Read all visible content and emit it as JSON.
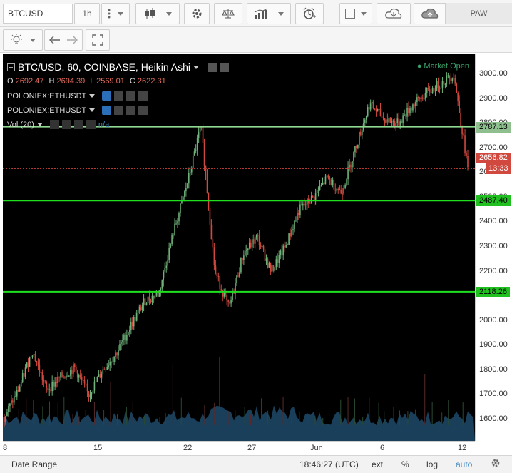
{
  "toolbar": {
    "symbol": "BTCUSD",
    "interval": "1h",
    "paw_label": "PAW",
    "icons": [
      "menu-dots-icon",
      "candles-icon",
      "settings-icon",
      "scales-icon",
      "indicators-icon",
      "alarm-clock-icon",
      "square-icon",
      "cloud-download-icon",
      "cloud-upload-icon"
    ]
  },
  "subtoolbar": {
    "icons": [
      "bulb-icon",
      "undo-icon",
      "redo-icon",
      "fullscreen-icon"
    ]
  },
  "legend": {
    "title": "BTC/USD, 60, COINBASE, Heikin Ashi",
    "o_label": "O",
    "o_value": "2692.47",
    "h_label": "H",
    "h_value": "2694.39",
    "l_label": "L",
    "l_value": "2569.01",
    "c_label": "C",
    "c_value": "2622.31",
    "overlays": [
      "POLONIEX:ETHUSDT",
      "POLONIEX:ETHUSDT"
    ],
    "volume_label": "Vol (20)",
    "volume_values": "n/a",
    "market_status": "Market Open"
  },
  "price_axis": {
    "ticks": [
      "3000.00",
      "2900.00",
      "2800.00",
      "2700.00",
      "2600.00",
      "2500.00",
      "2400.00",
      "2300.00",
      "2200.00",
      "2100.00",
      "2000.00",
      "1900.00",
      "1800.00",
      "1700.00",
      "1600.00"
    ],
    "tags": {
      "line1": "2787.13",
      "last": "2656.82",
      "countdown": "13:33",
      "line2": "2487.40",
      "line3": "2118.26"
    }
  },
  "time_axis": {
    "ticks": [
      "8",
      "15",
      "22",
      "27",
      "Jun",
      "6",
      "12"
    ]
  },
  "bottom_bar": {
    "date_range": "Date Range",
    "clock": "18:46:27 (UTC)",
    "ext": "ext",
    "percent": "%",
    "log": "log",
    "auto": "auto"
  },
  "colors": {
    "up": "#6fb27a",
    "down": "#d0483e",
    "hline": "#1fe01f",
    "hline_top": "#8fd88f",
    "bg": "#000000"
  },
  "chart_data": {
    "type": "candlestick",
    "title": "BTC/USD, 60, COINBASE, Heikin Ashi",
    "ylim": [
      1550,
      3050
    ],
    "horizontal_lines": [
      2787.13,
      2487.4,
      2118.26
    ],
    "last_price": 2656.82,
    "trend": [
      [
        1610,
        "8"
      ],
      [
        1720,
        "10"
      ],
      [
        1880,
        "11"
      ],
      [
        1720,
        "13"
      ],
      [
        1770,
        "14"
      ],
      [
        1810,
        "15"
      ],
      [
        1700,
        "16"
      ],
      [
        1800,
        "18"
      ],
      [
        1870,
        "19"
      ],
      [
        1980,
        "20"
      ],
      [
        2080,
        "21"
      ],
      [
        2110,
        "22"
      ],
      [
        2350,
        "23"
      ],
      [
        2550,
        "24"
      ],
      [
        2790,
        "25"
      ],
      [
        2200,
        "26"
      ],
      [
        2050,
        "27"
      ],
      [
        2270,
        "28"
      ],
      [
        2340,
        "29"
      ],
      [
        2200,
        "30"
      ],
      [
        2300,
        "31"
      ],
      [
        2450,
        "Jun"
      ],
      [
        2500,
        "2"
      ],
      [
        2580,
        "3"
      ],
      [
        2520,
        "4"
      ],
      [
        2700,
        "5"
      ],
      [
        2880,
        "6"
      ],
      [
        2820,
        "7"
      ],
      [
        2800,
        "8"
      ],
      [
        2870,
        "9"
      ],
      [
        2920,
        "10"
      ],
      [
        2960,
        "11"
      ],
      [
        3000,
        "12"
      ],
      [
        2620,
        "12b"
      ]
    ]
  }
}
